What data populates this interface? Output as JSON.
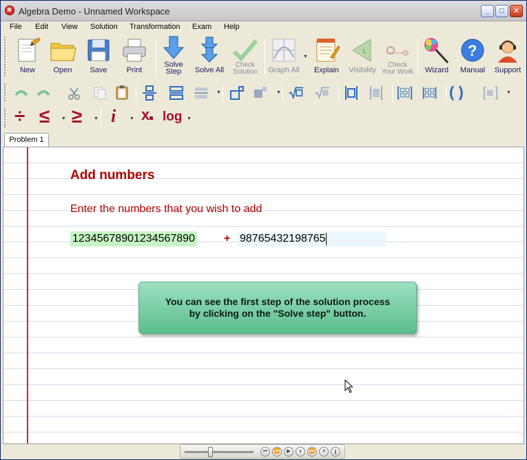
{
  "window": {
    "title": "Algebra Demo - Unnamed Workspace"
  },
  "menu": [
    "File",
    "Edit",
    "View",
    "Solution",
    "Transformation",
    "Exam",
    "Help"
  ],
  "toolbar": {
    "new": "New",
    "open": "Open",
    "save": "Save",
    "print": "Print",
    "solve_step_1": "Solve",
    "solve_step_2": "Step",
    "solve_all": "Solve All",
    "check_solution_1": "Check",
    "check_solution_2": "Solution",
    "graph_all": "Graph All",
    "explain": "Explain",
    "visibility": "Visibility",
    "check_work_1": "Check",
    "check_work_2": "Your Work",
    "wizard": "Wizard",
    "manual": "Manual",
    "support": "Support",
    "log_label": "log",
    "x_label": "x",
    "i_label": "i",
    "divide_glyph": "÷",
    "le_glyph": "≤",
    "ge_glyph": "≥",
    "paren_glyph": "( )",
    "manual_glyph": "?"
  },
  "tabs": [
    "Problem 1"
  ],
  "problem": {
    "heading": "Add numbers",
    "prompt": "Enter the numbers that you wish to add",
    "number1": "12345678901234567890",
    "operator": "+",
    "number2": "98765432198765"
  },
  "hint": {
    "line1": "You can see the first step of the solution process",
    "line2": "by clicking on the \"Solve step\" button."
  },
  "colors": {
    "accent": "#b20000",
    "hint_bg": "#7dd0a8",
    "input1_bg": "#c6f6c3",
    "input2_bg": "#eaf8fc"
  }
}
